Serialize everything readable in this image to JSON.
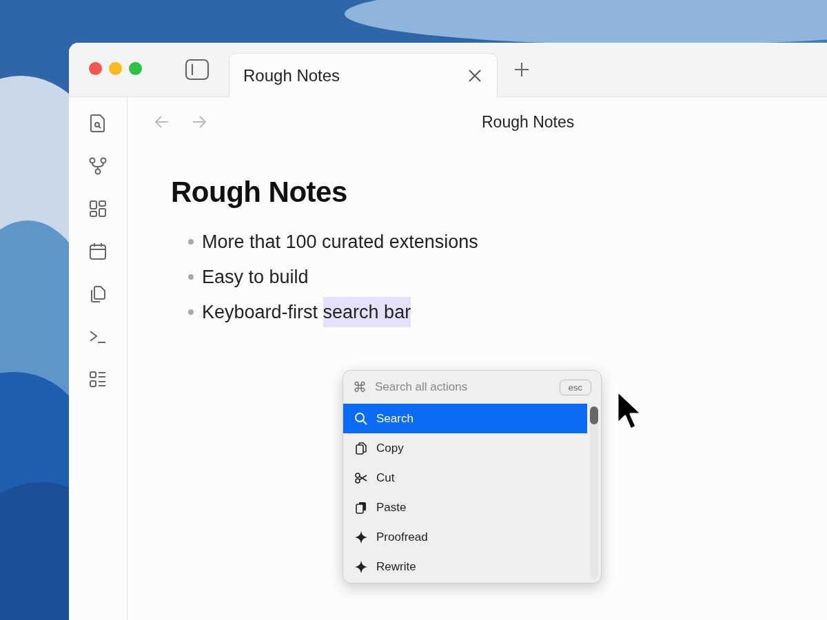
{
  "window": {
    "tab": {
      "title": "Rough Notes",
      "selected": true
    }
  },
  "sidebar": {
    "items": [
      {
        "kind": "file-search"
      },
      {
        "kind": "graph"
      },
      {
        "kind": "grid"
      },
      {
        "kind": "calendar"
      },
      {
        "kind": "copy"
      },
      {
        "kind": "terminal"
      },
      {
        "kind": "list"
      }
    ]
  },
  "header": {
    "title": "Rough Notes"
  },
  "note": {
    "title": "Rough Notes",
    "bullets": [
      {
        "segments": [
          {
            "text": "More that 100 curated extensions",
            "highlighted": false
          }
        ]
      },
      {
        "segments": [
          {
            "text": "Easy to build",
            "highlighted": false
          }
        ]
      },
      {
        "segments": [
          {
            "text": "Keyboard-first ",
            "highlighted": false
          },
          {
            "text": "search bar",
            "highlighted": true
          }
        ]
      }
    ]
  },
  "palette": {
    "shortcut_glyph": "⌘",
    "placeholder": "Search all actions",
    "esc": "esc",
    "items": [
      {
        "label": "Search",
        "kind": "search",
        "selected": true
      },
      {
        "label": "Copy",
        "kind": "copy",
        "selected": false
      },
      {
        "label": "Cut",
        "kind": "cut",
        "selected": false
      },
      {
        "label": "Paste",
        "kind": "paste",
        "selected": false
      },
      {
        "label": "Proofread",
        "kind": "ai",
        "selected": false
      },
      {
        "label": "Rewrite",
        "kind": "ai",
        "selected": false
      }
    ]
  }
}
